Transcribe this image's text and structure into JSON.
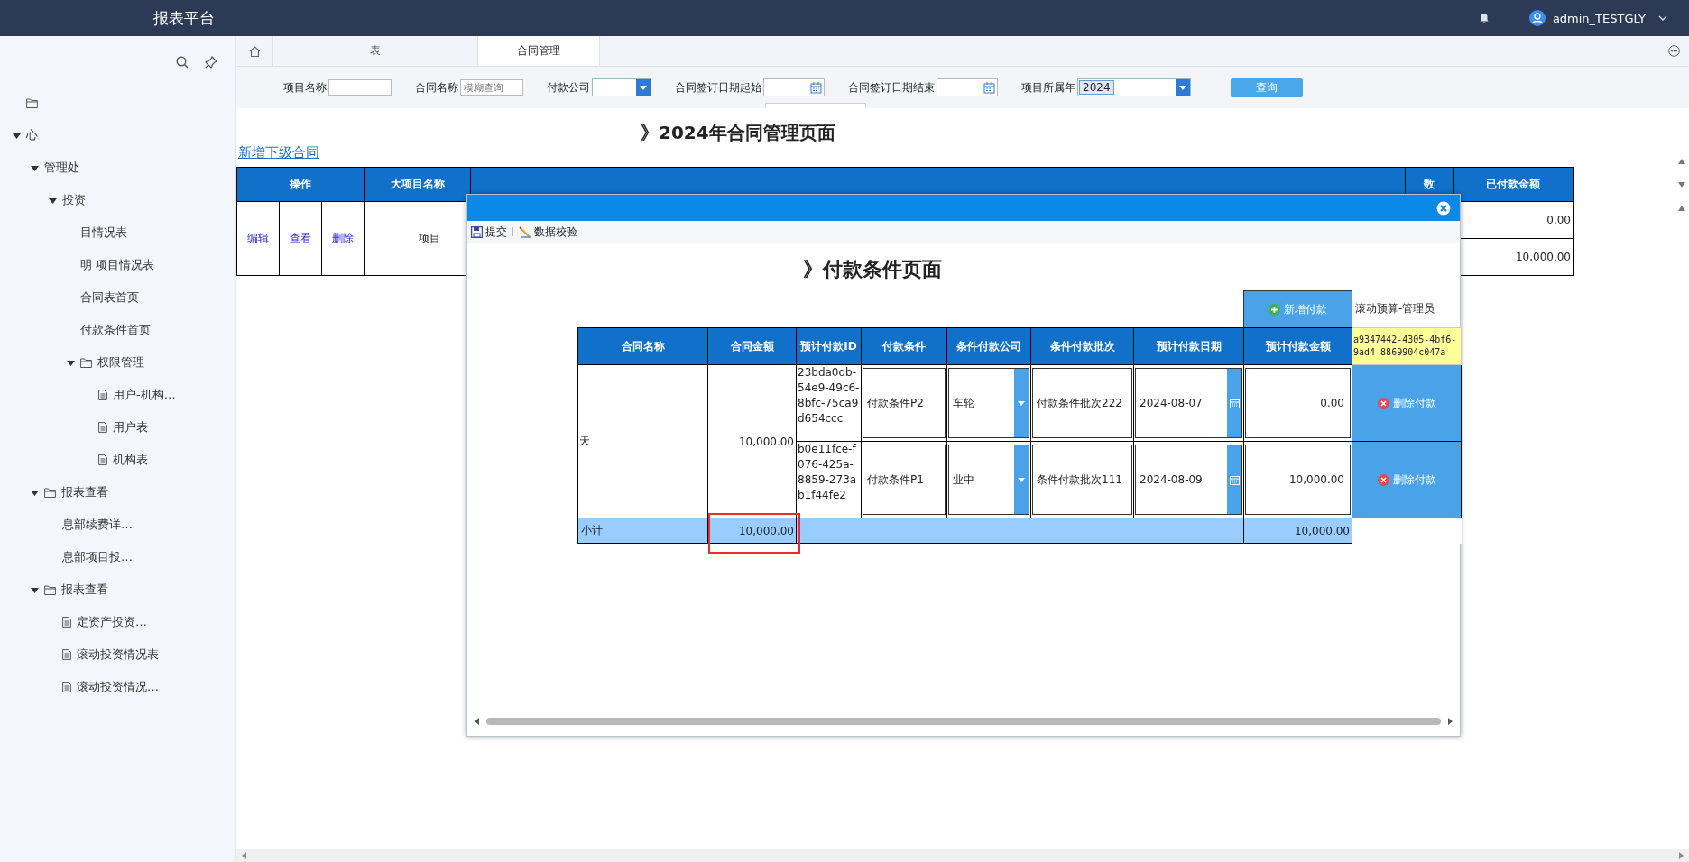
{
  "header": {
    "title": "报表平台",
    "user": "admin_TESTGLY"
  },
  "sidebar": {
    "items": [
      {
        "kind": "folder"
      },
      {
        "label": "心",
        "kind": "group",
        "expanded": true,
        "children": [
          {
            "label": "管理处",
            "kind": "group",
            "expanded": true,
            "children": [
              {
                "label": "投资",
                "kind": "group",
                "expanded": true,
                "children": [
                  {
                    "label": "目情况表",
                    "kind": "page"
                  },
                  {
                    "label": "明 项目情况表",
                    "kind": "page"
                  },
                  {
                    "label": "合同表首页",
                    "kind": "page"
                  },
                  {
                    "label": "付款条件首页",
                    "kind": "page"
                  },
                  {
                    "label": "权限管理",
                    "kind": "folder",
                    "expanded": true,
                    "children": [
                      {
                        "label": "用户-机构…",
                        "kind": "doc"
                      },
                      {
                        "label": "用户表",
                        "kind": "doc"
                      },
                      {
                        "label": "机构表",
                        "kind": "doc"
                      }
                    ]
                  }
                ]
              }
            ]
          },
          {
            "label": "报表查看",
            "kind": "folder",
            "expanded": true,
            "children": [
              {
                "label": "息部续费详…",
                "kind": "page"
              },
              {
                "label": "息部项目投…",
                "kind": "page"
              }
            ]
          },
          {
            "label": "报表查看",
            "kind": "folder",
            "expanded": true,
            "children": [
              {
                "label": "定资产投资…",
                "kind": "doc"
              },
              {
                "label": "滚动投资情况表",
                "kind": "doc"
              },
              {
                "label": "滚动投资情况…",
                "kind": "doc"
              }
            ]
          }
        ]
      }
    ]
  },
  "tabs": [
    {
      "kind": "home",
      "selected": false
    },
    {
      "label": "表",
      "selected": false
    },
    {
      "label": "合同管理",
      "selected": true
    }
  ],
  "filters": [
    {
      "label": "项目名称",
      "kind": "text"
    },
    {
      "label": "合同名称",
      "kind": "text",
      "placeholder": "模糊查询"
    },
    {
      "label": "付款公司",
      "kind": "select"
    },
    {
      "label": "合同签订日期起始",
      "kind": "date"
    },
    {
      "label": "合同签订日期结束",
      "kind": "date"
    },
    {
      "label": "项目所属年",
      "kind": "select",
      "value": "2024"
    }
  ],
  "query_button": "查询",
  "page_title": "》2024年合同管理页面",
  "add_link": "新增下级合同",
  "table": {
    "columns": [
      "操作",
      "大项目名称",
      "数",
      "已付款金额"
    ],
    "actions": [
      "编辑",
      "查看",
      "删除"
    ],
    "project": "项目",
    "paid": [
      "0.00",
      "10,000.00"
    ]
  },
  "dialog": {
    "toolbar": [
      "提交",
      "数据校验"
    ],
    "title": "》付款条件页面",
    "add_button": "新增付款",
    "user_label": "滚动预算-管理员",
    "guid": "a9347442-4305-4bf6-9ad4-8869904c047a",
    "columns": [
      "合同名称",
      "合同金额",
      "预计付款ID",
      "付款条件",
      "条件付款公司",
      "条件付款批次",
      "预计付款日期",
      "预计付款金额"
    ],
    "contract": "天",
    "contract_amount": "10,000.00",
    "payments": [
      {
        "id": "23bda0db-54e9-49c6-8bfc-75ca9d654ccc",
        "condition": "付款条件P2",
        "company": "车轮",
        "batch": "付款条件批次222",
        "date": "2024-08-07",
        "amount": "0.00",
        "delete": "删除付款"
      },
      {
        "id": "b0e11fce-f076-425a-8859-273ab1f44fe2",
        "condition": "付款条件P1",
        "company": "业中",
        "batch": "条件付款批次111",
        "date": "2024-08-09",
        "amount": "10,000.00",
        "delete": "删除付款"
      }
    ],
    "subtotal": {
      "label": "小计",
      "contract_amount": "10,000.00",
      "amount": "10,000.00",
      "highlighted": true
    }
  }
}
